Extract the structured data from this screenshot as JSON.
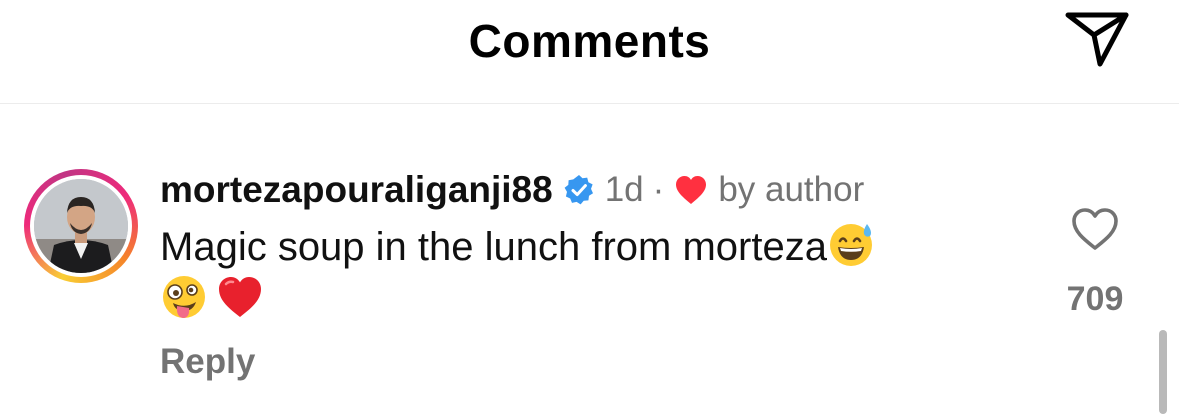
{
  "header": {
    "title": "Comments",
    "share_icon": "paper-plane-icon"
  },
  "comment": {
    "username": "mortezapouraliganji88",
    "verified_icon": "verified-badge-icon",
    "time": "1d",
    "separator": "·",
    "liked_by_author_icon": "heart-icon",
    "by_author": "by author",
    "text": "Magic soup in the lunch from morteza",
    "emojis": [
      "grinning-sweat-emoji",
      "zany-face-emoji",
      "red-heart-emoji"
    ],
    "reply_label": "Reply",
    "like_icon": "heart-outline-icon",
    "like_count": "709"
  },
  "colors": {
    "secondary_text": "#737373",
    "verified_blue": "#3797f0",
    "heart_red": "#ff3040",
    "divider": "#ececec"
  }
}
